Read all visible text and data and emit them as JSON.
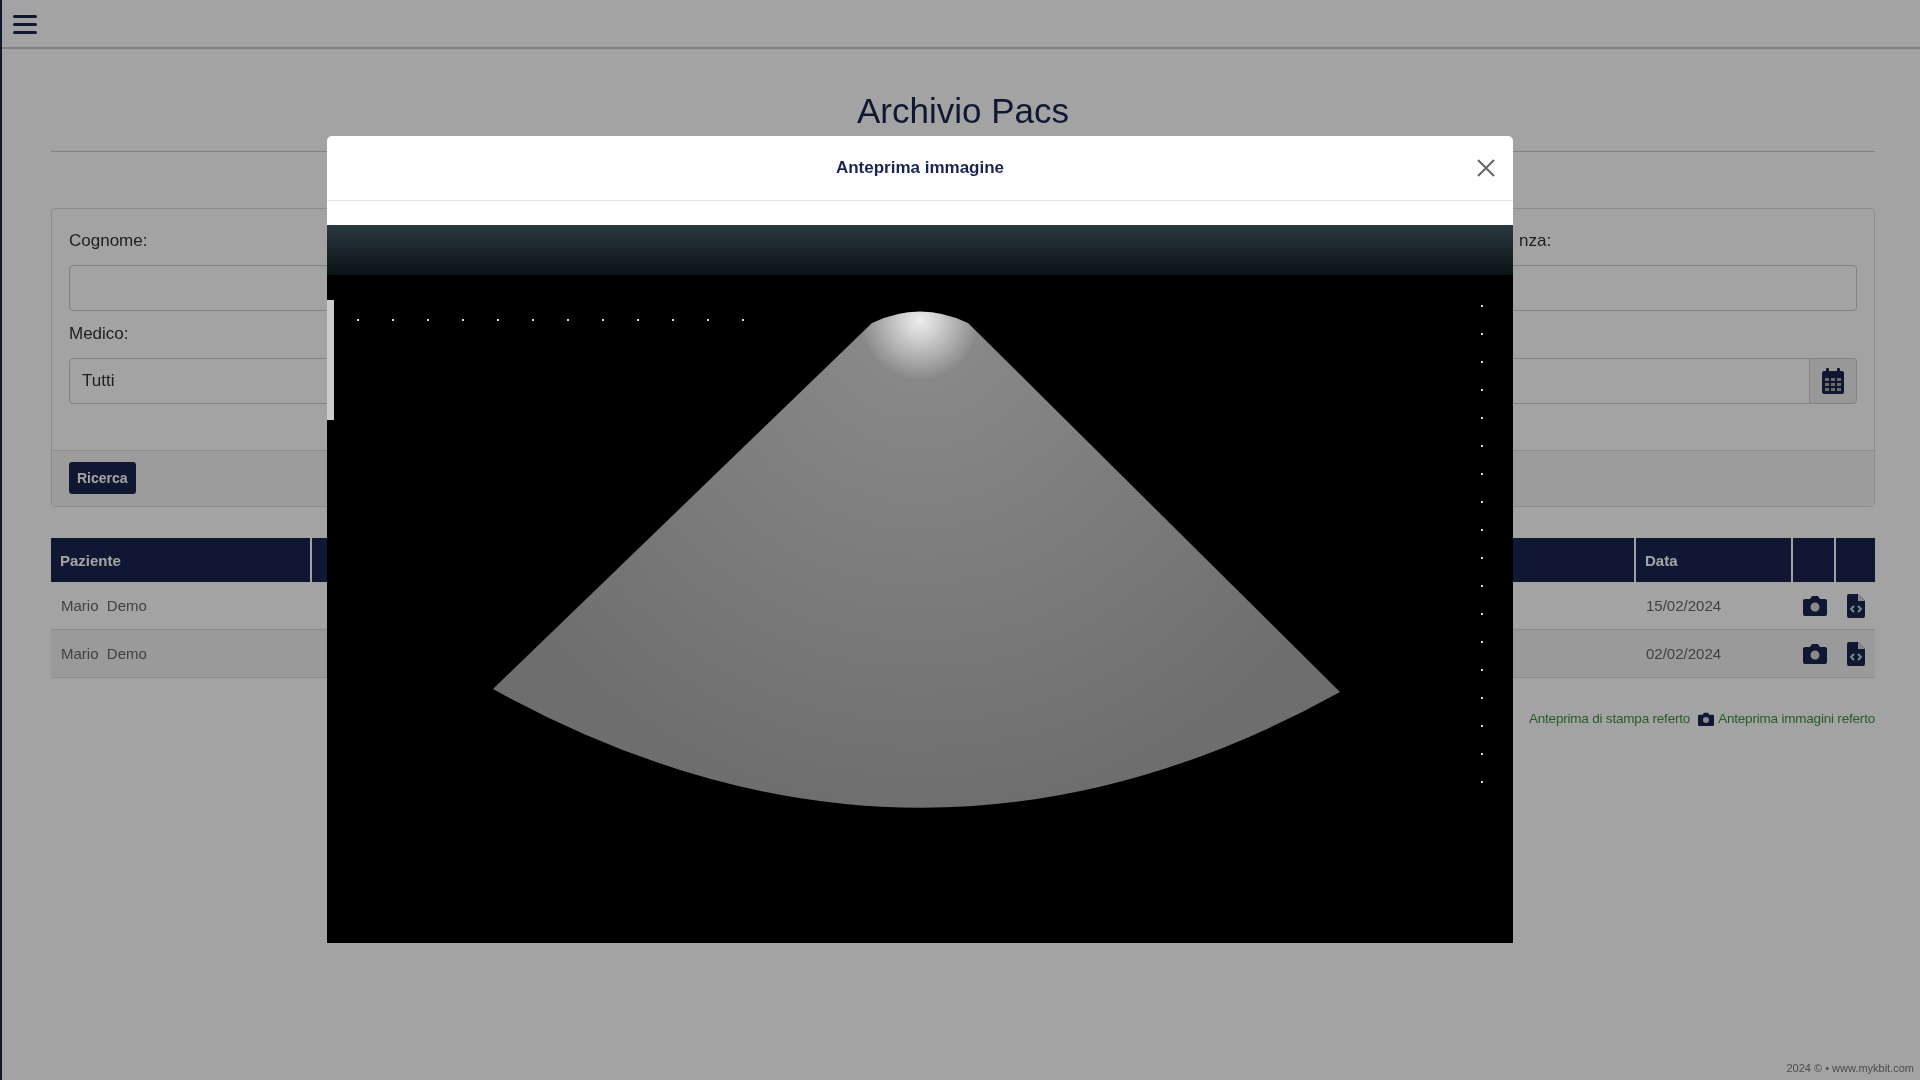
{
  "page": {
    "title": "Archivio Pacs"
  },
  "search_form": {
    "left_fields": [
      {
        "label": "Cognome:"
      },
      {
        "label": "Medico:",
        "value": "Tutti"
      }
    ],
    "right_fields": [
      {
        "label": "nza:",
        "kind": "text"
      },
      {
        "kind": "date"
      }
    ],
    "button": "Ricerca"
  },
  "table": {
    "columns": [
      {
        "label": "Paziente",
        "kind": "text"
      },
      {
        "kind": "spacer"
      },
      {
        "label": "Data",
        "kind": "text"
      },
      {
        "kind": "icon"
      },
      {
        "kind": "icon"
      }
    ],
    "rows": [
      {
        "paziente": "Mario  Demo",
        "data": "15/02/2024"
      },
      {
        "paziente": "Mario  Demo",
        "data": "02/02/2024"
      }
    ]
  },
  "legend": [
    {
      "kind": "print",
      "text": "Anteprima di stampa referto"
    },
    {
      "kind": "images",
      "text": "Anteprima immagini referto"
    }
  ],
  "footer": "2024 © • www.mykbit.com",
  "modal": {
    "title": "Anteprima immagine"
  }
}
